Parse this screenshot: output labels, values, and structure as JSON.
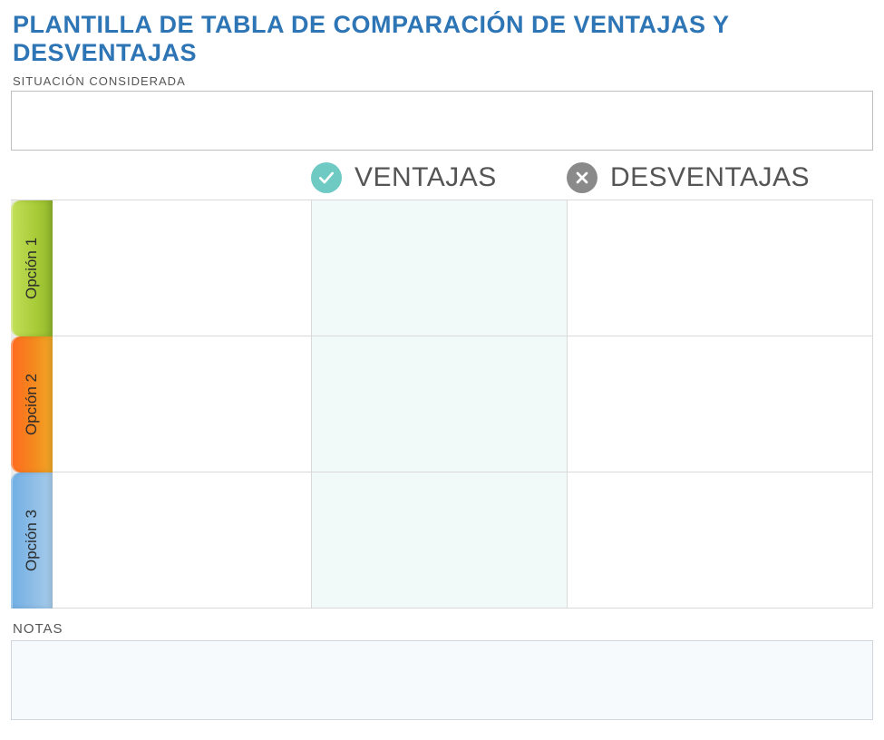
{
  "title": "PLANTILLA DE TABLA DE COMPARACIÓN DE VENTAJAS Y DESVENTAJAS",
  "situation_label": "SITUACIÓN CONSIDERADA",
  "situation_value": "",
  "headers": {
    "pros": "VENTAJAS",
    "cons": "DESVENTAJAS"
  },
  "options": [
    {
      "label": "Opción 1",
      "description": "",
      "pros": "",
      "cons": ""
    },
    {
      "label": "Opción 2",
      "description": "",
      "pros": "",
      "cons": ""
    },
    {
      "label": "Opción 3",
      "description": "",
      "pros": "",
      "cons": ""
    }
  ],
  "notes_label": "NOTAS",
  "notes_value": "",
  "colors": {
    "title": "#2E75B6",
    "pros_icon": "#6ECAC3",
    "cons_icon": "#8A8A8A",
    "pros_cell_bg": "#F1FAF9",
    "notes_bg": "#F7FAFD",
    "tab1": "#A8CB38",
    "tab2": "#F5861E",
    "tab3": "#8CBCE6"
  }
}
